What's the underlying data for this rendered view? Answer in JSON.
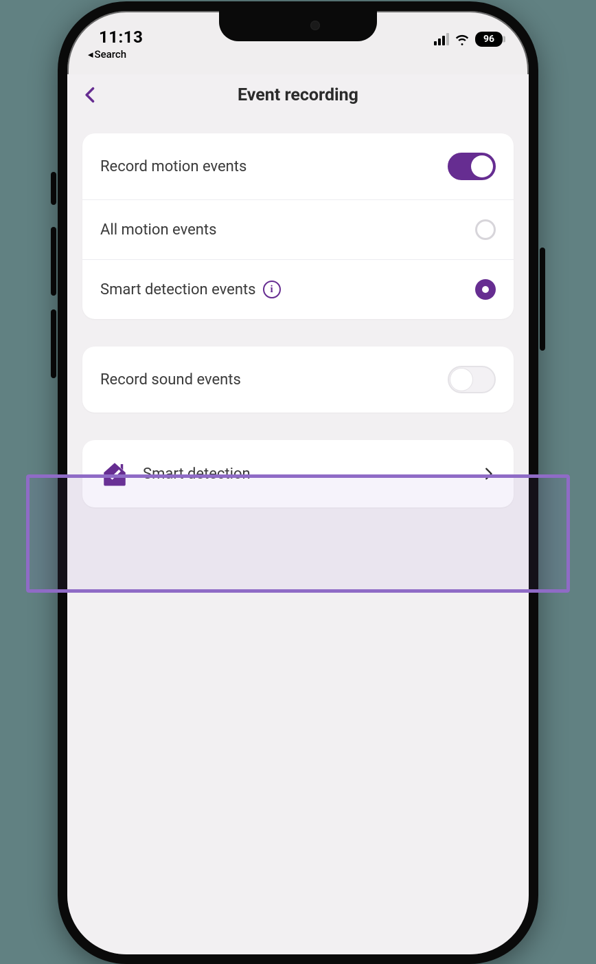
{
  "status": {
    "time": "11:13",
    "back_label": "Search",
    "battery": "96"
  },
  "header": {
    "title": "Event recording"
  },
  "sections": {
    "motion": {
      "record_label": "Record motion events",
      "record_on": true,
      "all_label": "All motion events",
      "all_selected": false,
      "smart_label": "Smart detection events",
      "smart_selected": true
    },
    "sound": {
      "record_label": "Record sound events",
      "record_on": false
    },
    "smart_nav": {
      "label": "Smart detection"
    }
  }
}
